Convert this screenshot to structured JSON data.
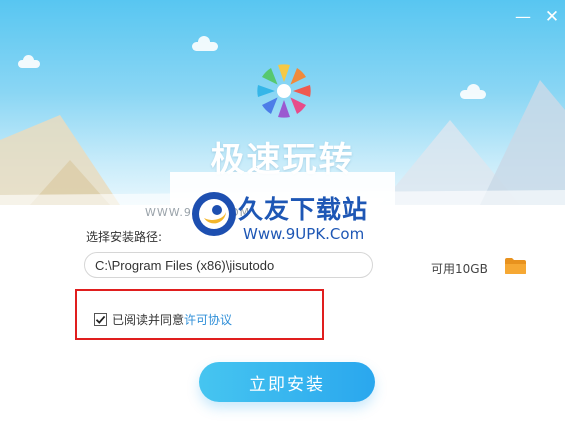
{
  "window": {
    "minimize_glyph": "—",
    "close_glyph": "✕"
  },
  "header": {
    "app_title": "极速玩转",
    "logo_icon": "pinwheel-logo-icon"
  },
  "watermark": {
    "small_url": "WWW.9UPK.COM",
    "site_name": "久友下载站",
    "site_url": "Www.9UPK.Com"
  },
  "install": {
    "path_label": "选择安装路径:",
    "path_value": "C:\\Program Files (x86)\\jisutodo",
    "available_space": "可用10GB",
    "folder_icon": "folder-icon"
  },
  "agreement": {
    "checked": true,
    "text": "已阅读并同意",
    "link_text": "许可协议"
  },
  "actions": {
    "install_button": "立即安装"
  },
  "colors": {
    "accent": "#2aa7ee",
    "link": "#2f8fd8",
    "highlight_border": "#e01e1e"
  }
}
